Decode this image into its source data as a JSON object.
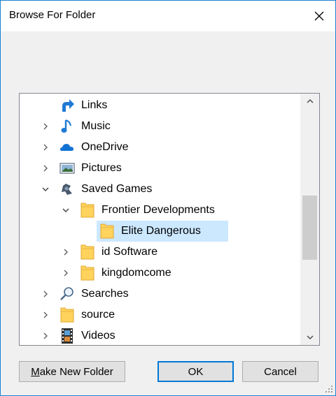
{
  "window": {
    "title": "Browse For Folder"
  },
  "tree": {
    "items": [
      {
        "label": "Links",
        "icon": "links-icon",
        "chevron": "none"
      },
      {
        "label": "Music",
        "icon": "music-icon",
        "chevron": "right"
      },
      {
        "label": "OneDrive",
        "icon": "onedrive-icon",
        "chevron": "right"
      },
      {
        "label": "Pictures",
        "icon": "pictures-icon",
        "chevron": "right"
      },
      {
        "label": "Saved Games",
        "icon": "saved-games-icon",
        "chevron": "down"
      },
      {
        "label": "Frontier Developments",
        "icon": "folder-icon",
        "chevron": "down"
      },
      {
        "label": "Elite Dangerous",
        "icon": "folder-icon",
        "chevron": "none",
        "selected": true
      },
      {
        "label": "id Software",
        "icon": "folder-icon",
        "chevron": "right"
      },
      {
        "label": "kingdomcome",
        "icon": "folder-icon",
        "chevron": "right"
      },
      {
        "label": "Searches",
        "icon": "search-icon",
        "chevron": "right"
      },
      {
        "label": "source",
        "icon": "folder-icon",
        "chevron": "right"
      },
      {
        "label": "Videos",
        "icon": "videos-icon",
        "chevron": "right"
      }
    ]
  },
  "buttons": {
    "make_new_folder_mnemonic": "M",
    "make_new_folder_rest": "ake New Folder",
    "ok": "OK",
    "cancel": "Cancel"
  },
  "colors": {
    "accent": "#0078d7",
    "selection": "#cce8ff",
    "folder": "#ffd35c"
  }
}
